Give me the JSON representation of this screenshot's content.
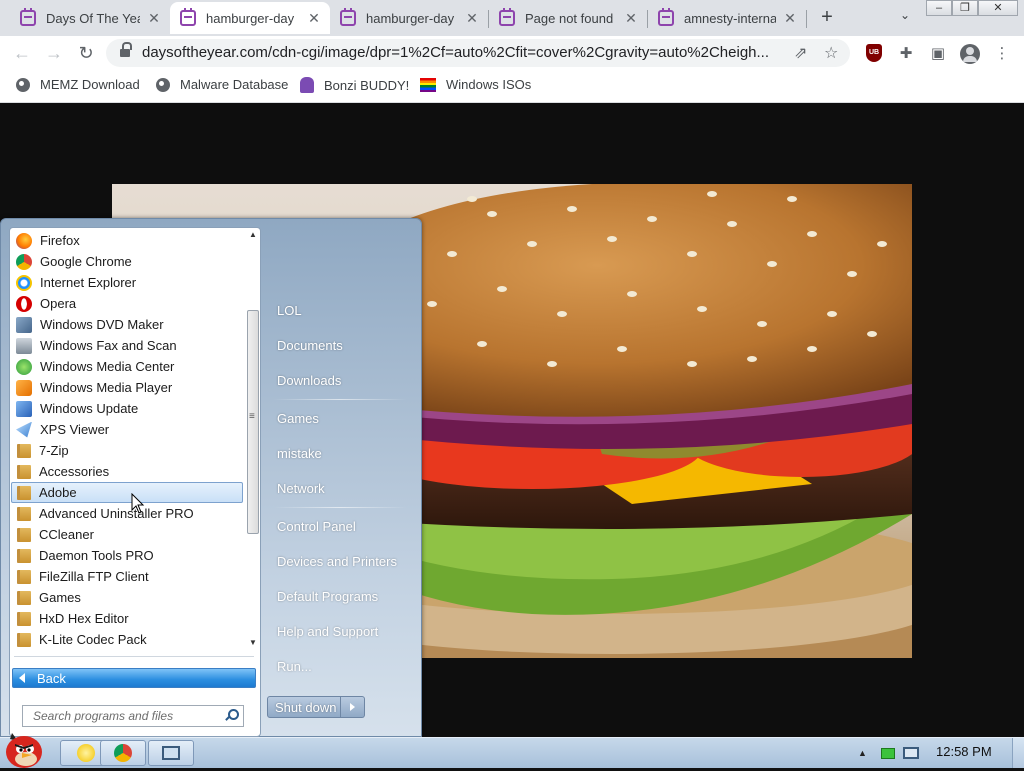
{
  "browser": {
    "tabs": [
      {
        "title": "Days Of The Year",
        "active": false
      },
      {
        "title": "hamburger-day",
        "active": true
      },
      {
        "title": "hamburger-day",
        "active": false
      },
      {
        "title": "Page not found",
        "active": false
      },
      {
        "title": "amnesty-interna",
        "active": false
      }
    ],
    "url": "daysoftheyear.com/cdn-cgi/image/dpr=1%2Cf=auto%2Cfit=cover%2Cgravity=auto%2Cheigh...",
    "bookmarks": [
      {
        "label": "MEMZ Download",
        "icon": "globe-icon"
      },
      {
        "label": "Malware Database",
        "icon": "globe-icon"
      },
      {
        "label": "Bonzi BUDDY!",
        "icon": "bonzi-icon"
      },
      {
        "label": "Windows ISOs",
        "icon": "rainbow-flag-icon"
      }
    ],
    "extension_badge": "UB"
  },
  "start_menu": {
    "programs": [
      {
        "label": "Firefox",
        "icon": "firefox-icon",
        "color": "#e66000"
      },
      {
        "label": "Google Chrome",
        "icon": "chrome-icon",
        "color": "#4285f4"
      },
      {
        "label": "Internet Explorer",
        "icon": "ie-icon",
        "color": "#1e90ff"
      },
      {
        "label": "Opera",
        "icon": "opera-icon",
        "color": "#d50000"
      },
      {
        "label": "Windows DVD Maker",
        "icon": "dvd-maker-icon",
        "color": "#5b7fa6"
      },
      {
        "label": "Windows Fax and Scan",
        "icon": "fax-icon",
        "color": "#6b7b8c"
      },
      {
        "label": "Windows Media Center",
        "icon": "media-center-icon",
        "color": "#2e9c3f"
      },
      {
        "label": "Windows Media Player",
        "icon": "media-player-icon",
        "color": "#f28a00"
      },
      {
        "label": "Windows Update",
        "icon": "windows-update-icon",
        "color": "#3a7bd5"
      },
      {
        "label": "XPS Viewer",
        "icon": "xps-viewer-icon",
        "color": "#4a90d9"
      },
      {
        "label": "7-Zip",
        "icon": "folder-icon",
        "color": "#d9a441"
      },
      {
        "label": "Accessories",
        "icon": "folder-icon",
        "color": "#d9a441"
      },
      {
        "label": "Adobe",
        "icon": "folder-icon",
        "color": "#d9a441",
        "selected": true
      },
      {
        "label": "Advanced Uninstaller PRO",
        "icon": "folder-icon",
        "color": "#d9a441"
      },
      {
        "label": "CCleaner",
        "icon": "folder-icon",
        "color": "#d9a441"
      },
      {
        "label": "Daemon Tools PRO",
        "icon": "folder-icon",
        "color": "#d9a441"
      },
      {
        "label": "FileZilla FTP Client",
        "icon": "folder-icon",
        "color": "#d9a441"
      },
      {
        "label": "Games",
        "icon": "folder-icon",
        "color": "#d9a441"
      },
      {
        "label": "HxD Hex Editor",
        "icon": "folder-icon",
        "color": "#d9a441"
      },
      {
        "label": "K-Lite Codec Pack",
        "icon": "folder-icon",
        "color": "#d9a441"
      }
    ],
    "back_label": "Back",
    "search_placeholder": "Search programs and files",
    "right_items": [
      "LOL",
      "Documents",
      "Downloads",
      "Games",
      "mistake",
      "Network",
      "Control Panel",
      "Devices and Printers",
      "Default Programs",
      "Help and Support",
      "Run..."
    ],
    "shutdown_label": "Shut down"
  },
  "taskbar": {
    "clock": "12:58 PM",
    "pinned": [
      "explorer-icon",
      "chrome-icon",
      "window-switcher-icon"
    ]
  }
}
